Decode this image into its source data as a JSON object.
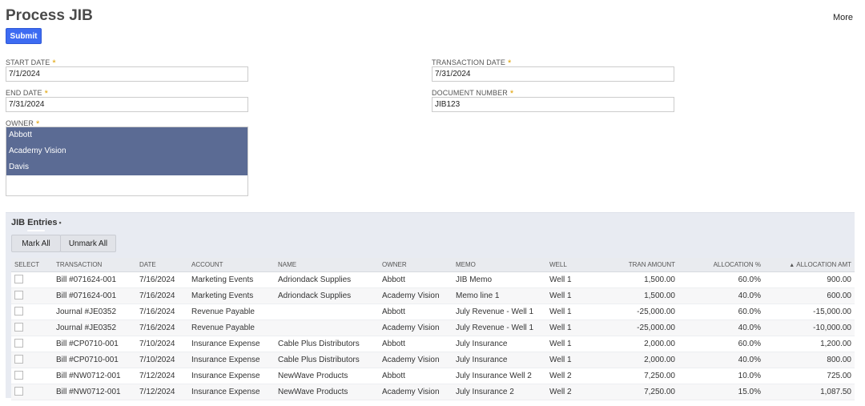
{
  "page": {
    "title": "Process JIB",
    "more_label": "More",
    "submit_label": "Submit"
  },
  "form": {
    "start_date": {
      "label": "START DATE",
      "value": "7/1/2024"
    },
    "end_date": {
      "label": "END DATE",
      "value": "7/31/2024"
    },
    "owner": {
      "label": "OWNER",
      "selected": [
        "Abbott",
        "Academy Vision",
        "Davis"
      ]
    },
    "transaction_date": {
      "label": "TRANSACTION DATE",
      "value": "7/31/2024"
    },
    "document_number": {
      "label": "DOCUMENT NUMBER",
      "value": "JIB123"
    },
    "required_mark": "*"
  },
  "sublist": {
    "title": "JIB Entries",
    "title_marker": "•",
    "mark_all_label": "Mark All",
    "unmark_all_label": "Unmark All",
    "columns": [
      "SELECT",
      "TRANSACTION",
      "DATE",
      "ACCOUNT",
      "NAME",
      "OWNER",
      "MEMO",
      "WELL",
      "TRAN AMOUNT",
      "ALLOCATION %",
      "ALLOCATION AMT"
    ],
    "sort_icon": "triangle-up-icon",
    "rows": [
      [
        "",
        "Bill #071624-001",
        "7/16/2024",
        "Marketing Events",
        "Adriondack Supplies",
        "Abbott",
        "JIB Memo",
        "Well 1",
        "1,500.00",
        "60.0%",
        "900.00"
      ],
      [
        "",
        "Bill #071624-001",
        "7/16/2024",
        "Marketing Events",
        "Adriondack Supplies",
        "Academy Vision",
        "Memo line 1",
        "Well 1",
        "1,500.00",
        "40.0%",
        "600.00"
      ],
      [
        "",
        "Journal #JE0352",
        "7/16/2024",
        "Revenue Payable",
        "",
        "Abbott",
        "July Revenue - Well 1",
        "Well 1",
        "-25,000.00",
        "60.0%",
        "-15,000.00"
      ],
      [
        "",
        "Journal #JE0352",
        "7/16/2024",
        "Revenue Payable",
        "",
        "Academy Vision",
        "July Revenue - Well 1",
        "Well 1",
        "-25,000.00",
        "40.0%",
        "-10,000.00"
      ],
      [
        "",
        "Bill #CP0710-001",
        "7/10/2024",
        "Insurance Expense",
        "Cable Plus Distributors",
        "Abbott",
        "July Insurance",
        "Well 1",
        "2,000.00",
        "60.0%",
        "1,200.00"
      ],
      [
        "",
        "Bill #CP0710-001",
        "7/10/2024",
        "Insurance Expense",
        "Cable Plus Distributors",
        "Academy Vision",
        "July Insurance",
        "Well 1",
        "2,000.00",
        "40.0%",
        "800.00"
      ],
      [
        "",
        "Bill #NW0712-001",
        "7/12/2024",
        "Insurance Expense",
        "NewWave Products",
        "Abbott",
        "July Insurance Well 2",
        "Well 2",
        "7,250.00",
        "10.0%",
        "725.00"
      ],
      [
        "",
        "Bill #NW0712-001",
        "7/12/2024",
        "Insurance Expense",
        "NewWave Products",
        "Academy Vision",
        "July Insurance 2",
        "Well 2",
        "7,250.00",
        "15.0%",
        "1,087.50"
      ]
    ]
  },
  "colors": {
    "accent": "#3d6bf2",
    "selected_owner": "#5b6b94",
    "sublist_bg": "#e8ebf2",
    "required": "#e0a100"
  }
}
